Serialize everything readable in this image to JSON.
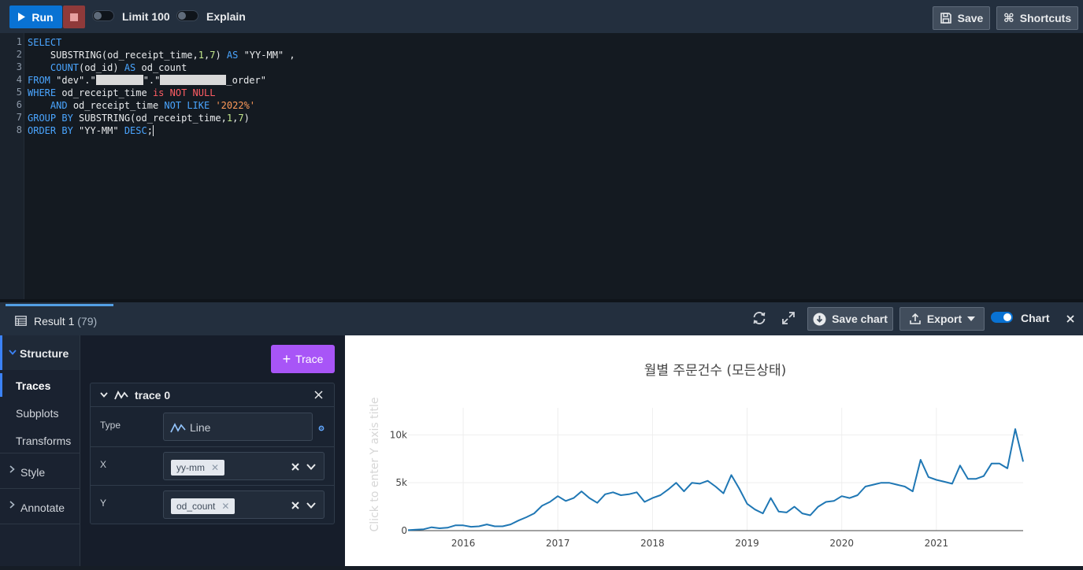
{
  "toolbar": {
    "run_label": "Run",
    "limit_label": "Limit 100",
    "explain_label": "Explain",
    "save_label": "Save",
    "shortcuts_label": "Shortcuts",
    "limit_on": false,
    "explain_on": false
  },
  "editor": {
    "line_numbers": [
      "1",
      "2",
      "3",
      "4",
      "5",
      "6",
      "7",
      "8"
    ],
    "lines": [
      [
        {
          "t": "SELECT",
          "c": "kw"
        }
      ],
      [
        {
          "t": "    SUBSTRING(od_receipt_time,",
          "c": ""
        },
        {
          "t": "1",
          "c": "num"
        },
        {
          "t": ",",
          "c": ""
        },
        {
          "t": "7",
          "c": "num"
        },
        {
          "t": ") ",
          "c": ""
        },
        {
          "t": "AS",
          "c": "kw"
        },
        {
          "t": " \"YY-MM\" ,",
          "c": ""
        }
      ],
      [
        {
          "t": "    ",
          "c": ""
        },
        {
          "t": "COUNT",
          "c": "kw"
        },
        {
          "t": "(od_id) ",
          "c": ""
        },
        {
          "t": "AS",
          "c": "kw"
        },
        {
          "t": " od_count",
          "c": ""
        }
      ],
      [
        {
          "t": "FROM",
          "c": "kw"
        },
        {
          "t": " \"dev\".\"",
          "c": ""
        },
        {
          "t": "",
          "c": "redact",
          "w": 60
        },
        {
          "t": "\".\"",
          "c": ""
        },
        {
          "t": "",
          "c": "redact",
          "w": 84
        },
        {
          "t": "_order\"",
          "c": ""
        }
      ],
      [
        {
          "t": "WHERE",
          "c": "kw"
        },
        {
          "t": " od_receipt_time ",
          "c": ""
        },
        {
          "t": "is NOT NULL",
          "c": "kwp"
        }
      ],
      [
        {
          "t": "    ",
          "c": ""
        },
        {
          "t": "AND",
          "c": "kw"
        },
        {
          "t": " od_receipt_time ",
          "c": ""
        },
        {
          "t": "NOT LIKE",
          "c": "kw"
        },
        {
          "t": " ",
          "c": ""
        },
        {
          "t": "'2022%'",
          "c": "str"
        }
      ],
      [
        {
          "t": "GROUP BY",
          "c": "kw"
        },
        {
          "t": " SUBSTRING(od_receipt_time,",
          "c": ""
        },
        {
          "t": "1",
          "c": "num"
        },
        {
          "t": ",",
          "c": ""
        },
        {
          "t": "7",
          "c": "num"
        },
        {
          "t": ")",
          "c": ""
        }
      ],
      [
        {
          "t": "ORDER BY",
          "c": "kw"
        },
        {
          "t": " \"YY-MM\" ",
          "c": ""
        },
        {
          "t": "DESC",
          "c": "kw"
        },
        {
          "t": ";",
          "c": ""
        },
        {
          "t": "",
          "c": "cursor"
        }
      ]
    ]
  },
  "results": {
    "tab_label": "Result 1",
    "tab_count": "(79)",
    "save_chart_label": "Save chart",
    "export_label": "Export",
    "chart_toggle_label": "Chart",
    "chart_on": true
  },
  "nav": {
    "structure_label": "Structure",
    "traces_label": "Traces",
    "subplots_label": "Subplots",
    "transforms_label": "Transforms",
    "style_label": "Style",
    "annotate_label": "Annotate"
  },
  "panel": {
    "add_trace_label": "Trace",
    "trace_name": "trace 0",
    "type_label": "Type",
    "type_value": "Line",
    "x_label": "X",
    "x_value": "yy-mm",
    "y_label": "Y",
    "y_value": "od_count"
  },
  "chart_data": {
    "type": "line",
    "title": "월별 주문건수 (모든상태)",
    "ylabel_placeholder": "Click to enter Y axis title",
    "xlabel": "",
    "ylim": [
      0,
      12000
    ],
    "xlim": [
      "2015-06",
      "2021-12"
    ],
    "yticks": [
      0,
      5000,
      10000
    ],
    "ytick_labels": [
      "0",
      "5k",
      "10k"
    ],
    "xticks": [
      "2016-01",
      "2017-01",
      "2018-01",
      "2019-01",
      "2020-01",
      "2021-01"
    ],
    "xtick_labels": [
      "2016",
      "2017",
      "2018",
      "2019",
      "2020",
      "2021"
    ],
    "line_color": "#1f77b4",
    "grid": true,
    "series": [
      {
        "x": [
          "2015-06",
          "2015-07",
          "2015-08",
          "2015-09",
          "2015-10",
          "2015-11",
          "2015-12",
          "2016-01",
          "2016-02",
          "2016-03",
          "2016-04",
          "2016-05",
          "2016-06",
          "2016-07",
          "2016-08",
          "2016-09",
          "2016-10",
          "2016-11",
          "2016-12",
          "2017-01",
          "2017-02",
          "2017-03",
          "2017-04",
          "2017-05",
          "2017-06",
          "2017-07",
          "2017-08",
          "2017-09",
          "2017-10",
          "2017-11",
          "2017-12",
          "2018-01",
          "2018-02",
          "2018-03",
          "2018-04",
          "2018-05",
          "2018-06",
          "2018-07",
          "2018-08",
          "2018-09",
          "2018-10",
          "2018-11",
          "2018-12",
          "2019-01",
          "2019-02",
          "2019-03",
          "2019-04",
          "2019-05",
          "2019-06",
          "2019-07",
          "2019-08",
          "2019-09",
          "2019-10",
          "2019-11",
          "2019-12",
          "2020-01",
          "2020-02",
          "2020-03",
          "2020-04",
          "2020-05",
          "2020-06",
          "2020-07",
          "2020-08",
          "2020-09",
          "2020-10",
          "2020-11",
          "2020-12",
          "2021-01",
          "2021-02",
          "2021-03",
          "2021-04",
          "2021-05",
          "2021-06",
          "2021-07",
          "2021-08",
          "2021-09",
          "2021-10",
          "2021-11",
          "2021-12"
        ],
        "values": [
          50,
          100,
          150,
          350,
          250,
          300,
          550,
          550,
          400,
          450,
          650,
          450,
          450,
          650,
          1050,
          1400,
          1800,
          2600,
          3000,
          3600,
          3100,
          3400,
          4100,
          3400,
          2900,
          3800,
          4000,
          3700,
          3800,
          4000,
          3000,
          3400,
          3700,
          4300,
          5000,
          4100,
          5000,
          4900,
          5200,
          4600,
          3900,
          5800,
          4400,
          2800,
          2200,
          1800,
          3400,
          2000,
          1900,
          2500,
          1800,
          1600,
          2500,
          3000,
          3100,
          3600,
          3400,
          3700,
          4600,
          4800,
          5000,
          5000,
          4800,
          4600,
          4100,
          7400,
          5600,
          5300,
          5100,
          4900,
          6800,
          5400,
          5400,
          5700,
          7000,
          7000,
          6500,
          10600,
          7200
        ]
      }
    ]
  }
}
